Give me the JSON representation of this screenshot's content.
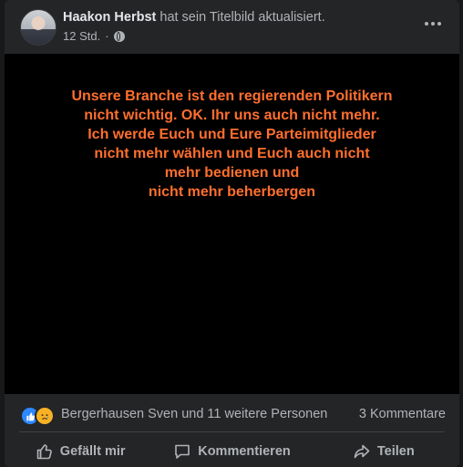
{
  "post": {
    "author": "Haakon Herbst",
    "action": "hat sein Titelbild aktualisiert.",
    "time": "12 Std.",
    "separator": "·"
  },
  "cover": {
    "lines": [
      "Unsere Branche ist den regierenden Politikern",
      "nicht wichtig. OK. Ihr uns auch nicht mehr.",
      "Ich werde Euch und Eure Parteimitglieder",
      "nicht mehr wählen und Euch auch nicht",
      "mehr bedienen und",
      "nicht mehr beherbergen"
    ],
    "text_color": "#ff6f2e"
  },
  "stats": {
    "reactions_text": "Bergerhausen Sven und 11 weitere Personen",
    "comments_text": "3 Kommentare"
  },
  "actions": {
    "like": "Gefällt mir",
    "comment": "Kommentieren",
    "share": "Teilen"
  },
  "colors": {
    "background": "#18191a",
    "card": "#242526",
    "primary_text": "#e4e6eb",
    "secondary_text": "#b0b3b8",
    "like_blue": "#2d88ff",
    "sad_yellow": "#f7b125"
  }
}
